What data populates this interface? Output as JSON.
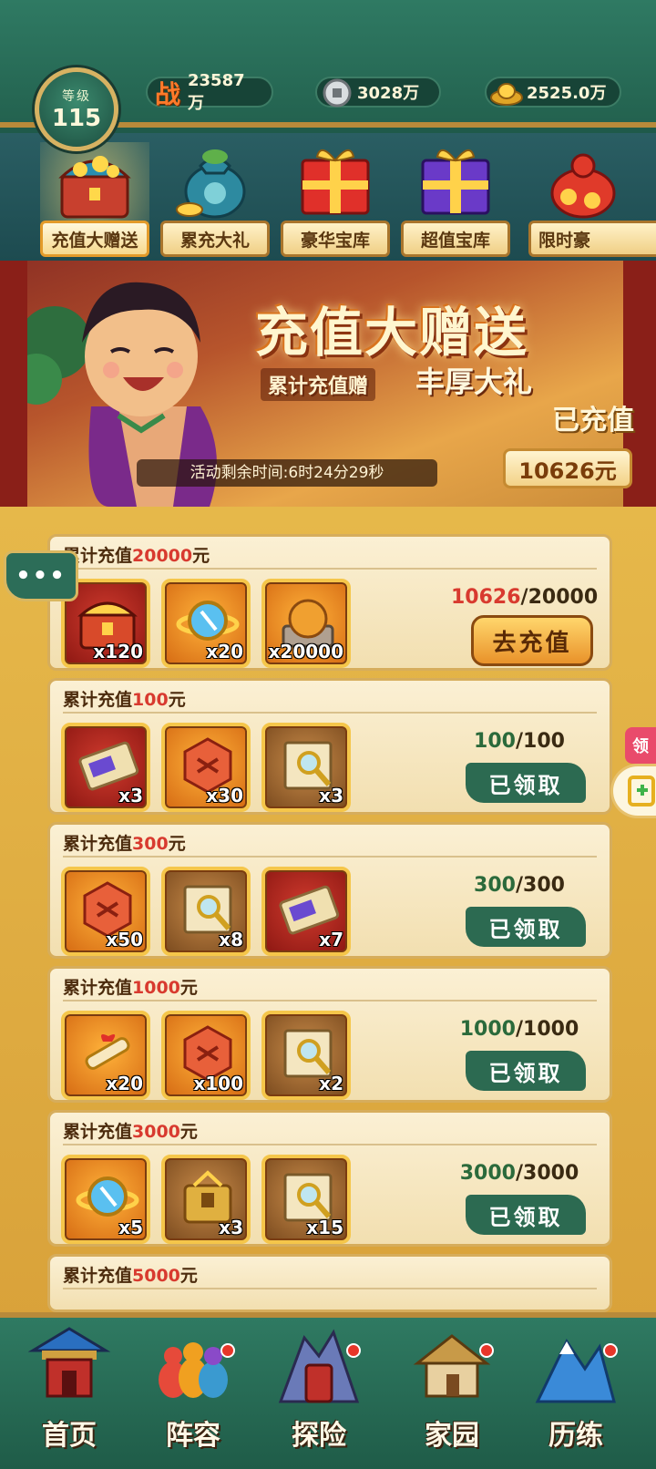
{
  "header": {
    "level_label": "等级",
    "level": "115",
    "power_icon_text": "战",
    "power": "23587万",
    "silver": "3028万",
    "gold": "2525.0万"
  },
  "tabs": [
    {
      "label": "充值大赠送",
      "active": true
    },
    {
      "label": "累充大礼",
      "active": false
    },
    {
      "label": "豪华宝库",
      "active": false
    },
    {
      "label": "超值宝库",
      "active": false
    },
    {
      "label": "限时豪",
      "active": false
    }
  ],
  "banner": {
    "title": "充值大赠送",
    "subtitle_left": "累计充值赠",
    "subtitle_right": "丰厚大礼",
    "countdown": "活动剩余时间:6时24分29秒",
    "recharged_label": "已充值",
    "recharged_amount": "10626元"
  },
  "side": {
    "chat_dots": "•••",
    "side_tab": "领"
  },
  "tiers": [
    {
      "title_prefix": "累计充值",
      "amount": "20000",
      "title_suffix": "元",
      "progress_cur": "10626",
      "progress_total": "/20000",
      "button": "去充值",
      "claimed": false,
      "items": [
        {
          "qty": "x120",
          "style": "red",
          "icon": "treasure-chest-icon"
        },
        {
          "qty": "x20",
          "style": "orange",
          "icon": "golden-orb-icon"
        },
        {
          "qty": "x20000",
          "style": "orange",
          "icon": "bronze-ball-icon"
        }
      ]
    },
    {
      "title_prefix": "累计充值",
      "amount": "100",
      "title_suffix": "元",
      "progress_cur": "100",
      "progress_total": "/100",
      "button": "已领取",
      "claimed": true,
      "items": [
        {
          "qty": "x3",
          "style": "red",
          "icon": "ticket-icon"
        },
        {
          "qty": "x30",
          "style": "orange",
          "icon": "red-gem-icon"
        },
        {
          "qty": "x3",
          "style": "brown",
          "icon": "treasure-map-icon"
        }
      ]
    },
    {
      "title_prefix": "累计充值",
      "amount": "300",
      "title_suffix": "元",
      "progress_cur": "300",
      "progress_total": "/300",
      "button": "已领取",
      "claimed": true,
      "items": [
        {
          "qty": "x50",
          "style": "orange",
          "icon": "red-gem-icon"
        },
        {
          "qty": "x8",
          "style": "brown",
          "icon": "treasure-map-icon"
        },
        {
          "qty": "x7",
          "style": "red",
          "icon": "ticket-icon"
        }
      ]
    },
    {
      "title_prefix": "累计充值",
      "amount": "1000",
      "title_suffix": "元",
      "progress_cur": "1000",
      "progress_total": "/1000",
      "button": "已领取",
      "claimed": true,
      "items": [
        {
          "qty": "x20",
          "style": "orange",
          "icon": "scroll-icon"
        },
        {
          "qty": "x100",
          "style": "orange",
          "icon": "red-gem-icon"
        },
        {
          "qty": "x2",
          "style": "brown",
          "icon": "treasure-map-icon"
        }
      ]
    },
    {
      "title_prefix": "累计充值",
      "amount": "3000",
      "title_suffix": "元",
      "progress_cur": "3000",
      "progress_total": "/3000",
      "button": "已领取",
      "claimed": true,
      "items": [
        {
          "qty": "x5",
          "style": "orange",
          "icon": "golden-orb-icon"
        },
        {
          "qty": "x3",
          "style": "brown",
          "icon": "golden-chest-icon"
        },
        {
          "qty": "x15",
          "style": "brown",
          "icon": "treasure-map-icon"
        }
      ]
    },
    {
      "title_prefix": "累计充值",
      "amount": "5000",
      "title_suffix": "元"
    }
  ],
  "nav": [
    {
      "label": "首页",
      "dot": false
    },
    {
      "label": "阵容",
      "dot": true
    },
    {
      "label": "探险",
      "dot": true
    },
    {
      "label": "家园",
      "dot": true
    },
    {
      "label": "历练",
      "dot": true
    }
  ]
}
